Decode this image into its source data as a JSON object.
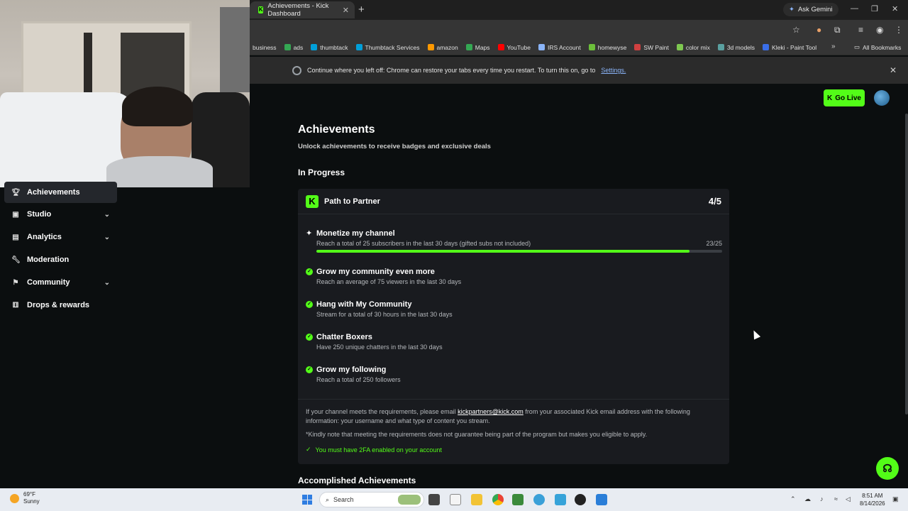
{
  "browser": {
    "tab_title": "Achievements - Kick Dashboard",
    "tab_close": "✕",
    "new_tab": "+",
    "ask_gemini": "Ask Gemini",
    "bookmarks": [
      {
        "label": "business",
        "color": "#555"
      },
      {
        "label": "ads",
        "color": "#34a853"
      },
      {
        "label": "thumbtack",
        "color": "#009fd9"
      },
      {
        "label": "Thumbtack Services",
        "color": "#009fd9"
      },
      {
        "label": "amazon",
        "color": "#ff9900"
      },
      {
        "label": "Maps",
        "color": "#34a853"
      },
      {
        "label": "YouTube",
        "color": "#ff0000"
      },
      {
        "label": "IRS Account",
        "color": "#8ab4f8"
      },
      {
        "label": "homewyse",
        "color": "#6cbf3a"
      },
      {
        "label": "SW Paint",
        "color": "#d04040"
      },
      {
        "label": "color mix",
        "color": "#7ec850"
      },
      {
        "label": "3d models",
        "color": "#5aa0a0"
      },
      {
        "label": "Kleki - Paint Tool",
        "color": "#3a6ee8"
      }
    ],
    "all_bookmarks": "All Bookmarks",
    "banner_text": "Continue where you left off: Chrome can restore your tabs every time you restart. To turn this on, go to",
    "banner_link": "Settings."
  },
  "sidebar": {
    "items": [
      {
        "label": "Achievements",
        "icon": "trophy-icon",
        "active": true
      },
      {
        "label": "Studio",
        "icon": "studio-icon",
        "chevron": true
      },
      {
        "label": "Analytics",
        "icon": "analytics-icon",
        "chevron": true
      },
      {
        "label": "Moderation",
        "icon": "wrench-icon"
      },
      {
        "label": "Community",
        "icon": "community-icon",
        "chevron": true
      },
      {
        "label": "Drops & rewards",
        "icon": "gift-icon"
      }
    ]
  },
  "header": {
    "go_live": "Go Live"
  },
  "main": {
    "title": "Achievements",
    "subtitle": "Unlock achievements to receive badges and exclusive deals",
    "in_progress": "In Progress",
    "card": {
      "title": "Path to Partner",
      "count": "4/5",
      "achievements": [
        {
          "name": "Monetize my channel",
          "desc": "Reach a total of 25 subscribers in the last 30 days (gifted subs not included)",
          "progress_text": "23/25",
          "progress": 0.92,
          "done": false
        },
        {
          "name": "Grow my community even more",
          "desc": "Reach an average of 75 viewers in the last 30 days",
          "done": true
        },
        {
          "name": "Hang with My Community",
          "desc": "Stream for a total of 30 hours in the last 30 days",
          "done": true
        },
        {
          "name": "Chatter Boxers",
          "desc": "Have 250 unique chatters in the last 30 days",
          "done": true
        },
        {
          "name": "Grow my following",
          "desc": "Reach a total of 250 followers",
          "done": true
        }
      ],
      "footer_prefix": "If your channel meets the requirements, please email",
      "footer_email": "kickpartners@kick.com",
      "footer_suffix": "from your associated Kick email address with the following information: your username and what type of content you stream.",
      "footer_note": "*Kindly note that meeting the requirements does not guarantee being part of the program but makes you eligible to apply.",
      "twofa": "You must have 2FA enabled on your account"
    },
    "accomplished": "Accomplished Achievements"
  },
  "taskbar": {
    "weather_temp": "69°F",
    "weather_desc": "Sunny",
    "search_placeholder": "Search",
    "time": "8:51 AM",
    "date": "8/14/2026"
  }
}
